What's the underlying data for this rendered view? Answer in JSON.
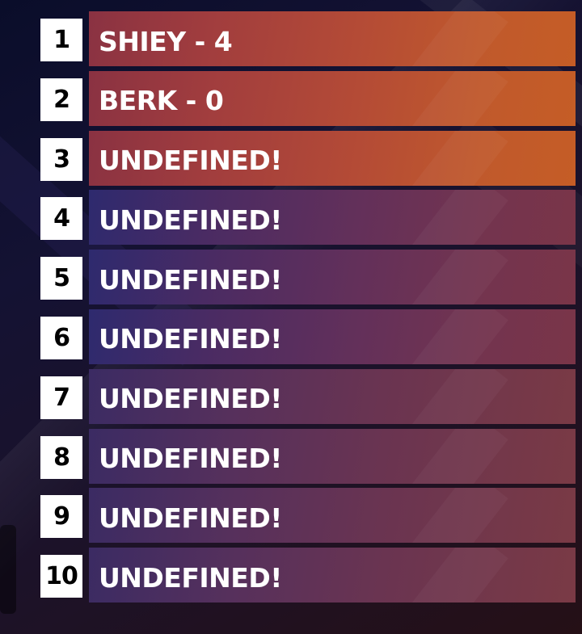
{
  "leaderboard": {
    "entries": [
      {
        "rank": "1",
        "label": "SHIEY - 4",
        "style": "orange"
      },
      {
        "rank": "2",
        "label": "BERK - 0",
        "style": "orange"
      },
      {
        "rank": "3",
        "label": "UNDEFINED!",
        "style": "orange"
      },
      {
        "rank": "4",
        "label": "UNDEFINED!",
        "style": "purple"
      },
      {
        "rank": "5",
        "label": "UNDEFINED!",
        "style": "purple"
      },
      {
        "rank": "6",
        "label": "UNDEFINED!",
        "style": "purple"
      },
      {
        "rank": "7",
        "label": "UNDEFINED!",
        "style": "purple"
      },
      {
        "rank": "8",
        "label": "UNDEFINED!",
        "style": "purple"
      },
      {
        "rank": "9",
        "label": "UNDEFINED!",
        "style": "purple"
      },
      {
        "rank": "10",
        "label": "UNDEFINED!",
        "style": "purple"
      }
    ]
  },
  "colors": {
    "rank_box": "#ffffff",
    "rank_text": "#000000",
    "label_text": "#ffffff",
    "top_bar": "#c0592c",
    "other_bar": "#63305a",
    "background": "#141233"
  }
}
